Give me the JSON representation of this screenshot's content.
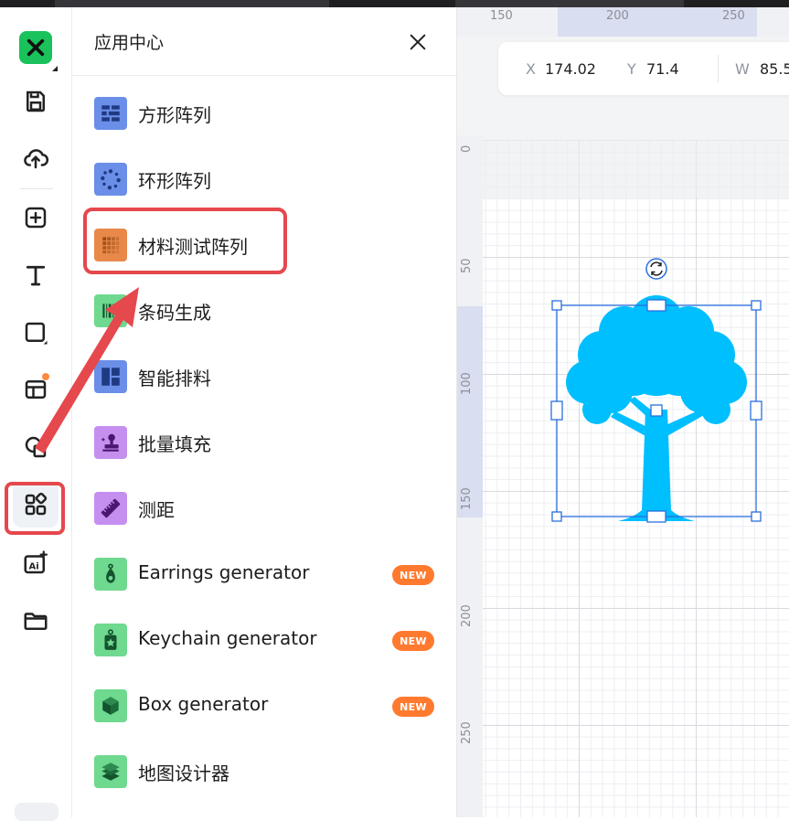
{
  "app": {
    "brand_color": "#19c25a",
    "accent_highlight": "#e5484d"
  },
  "toolbar": {
    "items": [
      {
        "name": "logo",
        "icon": "xtool-logo-icon"
      },
      {
        "name": "save",
        "icon": "save-icon"
      },
      {
        "name": "upload",
        "icon": "cloud-upload-icon"
      },
      {
        "name": "add",
        "icon": "add-square-icon"
      },
      {
        "name": "text",
        "icon": "text-icon"
      },
      {
        "name": "shape",
        "icon": "square-icon"
      },
      {
        "name": "layout",
        "icon": "template-icon"
      },
      {
        "name": "shapes",
        "icon": "shapes-icon"
      },
      {
        "name": "apps",
        "icon": "apps-grid-icon",
        "active": true
      },
      {
        "name": "ai",
        "icon": "ai-image-icon"
      },
      {
        "name": "folder",
        "icon": "folder-icon"
      }
    ]
  },
  "panel": {
    "title": "应用中心",
    "items": [
      {
        "label": "方形阵列",
        "icon": "square-array-icon"
      },
      {
        "label": "环形阵列",
        "icon": "circular-array-icon"
      },
      {
        "label": "材料测试阵列",
        "icon": "material-test-array-icon",
        "highlighted": true
      },
      {
        "label": "条码生成",
        "icon": "barcode-icon"
      },
      {
        "label": "智能排料",
        "icon": "smart-nesting-icon"
      },
      {
        "label": "批量填充",
        "icon": "batch-fill-icon"
      },
      {
        "label": "测距",
        "icon": "ruler-icon"
      },
      {
        "label": "Earrings generator",
        "icon": "earring-icon",
        "badge": "NEW"
      },
      {
        "label": "Keychain generator",
        "icon": "keychain-icon",
        "badge": "NEW"
      },
      {
        "label": "Box generator",
        "icon": "box-icon",
        "badge": "NEW"
      },
      {
        "label": "地图设计器",
        "icon": "map-layers-icon"
      }
    ]
  },
  "canvas": {
    "ruler_top": [
      "150",
      "200",
      "250"
    ],
    "ruler_left": [
      "0",
      "50",
      "100",
      "150",
      "200",
      "250"
    ],
    "props": {
      "x_label": "X",
      "x_value": "174.02",
      "y_label": "Y",
      "y_value": "71.4",
      "w_label": "W",
      "w_value": "85.5"
    },
    "object": {
      "type": "tree-silhouette",
      "color": "#00bfff"
    }
  }
}
